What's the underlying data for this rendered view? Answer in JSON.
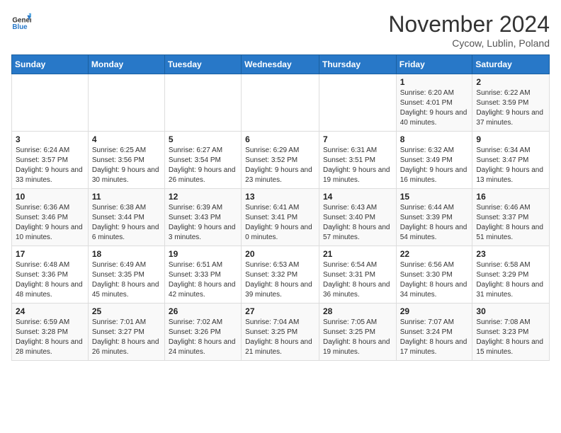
{
  "header": {
    "logo_general": "General",
    "logo_blue": "Blue",
    "month_year": "November 2024",
    "location": "Cycow, Lublin, Poland"
  },
  "weekdays": [
    "Sunday",
    "Monday",
    "Tuesday",
    "Wednesday",
    "Thursday",
    "Friday",
    "Saturday"
  ],
  "weeks": [
    [
      {
        "day": "",
        "info": ""
      },
      {
        "day": "",
        "info": ""
      },
      {
        "day": "",
        "info": ""
      },
      {
        "day": "",
        "info": ""
      },
      {
        "day": "",
        "info": ""
      },
      {
        "day": "1",
        "info": "Sunrise: 6:20 AM\nSunset: 4:01 PM\nDaylight: 9 hours and 40 minutes."
      },
      {
        "day": "2",
        "info": "Sunrise: 6:22 AM\nSunset: 3:59 PM\nDaylight: 9 hours and 37 minutes."
      }
    ],
    [
      {
        "day": "3",
        "info": "Sunrise: 6:24 AM\nSunset: 3:57 PM\nDaylight: 9 hours and 33 minutes."
      },
      {
        "day": "4",
        "info": "Sunrise: 6:25 AM\nSunset: 3:56 PM\nDaylight: 9 hours and 30 minutes."
      },
      {
        "day": "5",
        "info": "Sunrise: 6:27 AM\nSunset: 3:54 PM\nDaylight: 9 hours and 26 minutes."
      },
      {
        "day": "6",
        "info": "Sunrise: 6:29 AM\nSunset: 3:52 PM\nDaylight: 9 hours and 23 minutes."
      },
      {
        "day": "7",
        "info": "Sunrise: 6:31 AM\nSunset: 3:51 PM\nDaylight: 9 hours and 19 minutes."
      },
      {
        "day": "8",
        "info": "Sunrise: 6:32 AM\nSunset: 3:49 PM\nDaylight: 9 hours and 16 minutes."
      },
      {
        "day": "9",
        "info": "Sunrise: 6:34 AM\nSunset: 3:47 PM\nDaylight: 9 hours and 13 minutes."
      }
    ],
    [
      {
        "day": "10",
        "info": "Sunrise: 6:36 AM\nSunset: 3:46 PM\nDaylight: 9 hours and 10 minutes."
      },
      {
        "day": "11",
        "info": "Sunrise: 6:38 AM\nSunset: 3:44 PM\nDaylight: 9 hours and 6 minutes."
      },
      {
        "day": "12",
        "info": "Sunrise: 6:39 AM\nSunset: 3:43 PM\nDaylight: 9 hours and 3 minutes."
      },
      {
        "day": "13",
        "info": "Sunrise: 6:41 AM\nSunset: 3:41 PM\nDaylight: 9 hours and 0 minutes."
      },
      {
        "day": "14",
        "info": "Sunrise: 6:43 AM\nSunset: 3:40 PM\nDaylight: 8 hours and 57 minutes."
      },
      {
        "day": "15",
        "info": "Sunrise: 6:44 AM\nSunset: 3:39 PM\nDaylight: 8 hours and 54 minutes."
      },
      {
        "day": "16",
        "info": "Sunrise: 6:46 AM\nSunset: 3:37 PM\nDaylight: 8 hours and 51 minutes."
      }
    ],
    [
      {
        "day": "17",
        "info": "Sunrise: 6:48 AM\nSunset: 3:36 PM\nDaylight: 8 hours and 48 minutes."
      },
      {
        "day": "18",
        "info": "Sunrise: 6:49 AM\nSunset: 3:35 PM\nDaylight: 8 hours and 45 minutes."
      },
      {
        "day": "19",
        "info": "Sunrise: 6:51 AM\nSunset: 3:33 PM\nDaylight: 8 hours and 42 minutes."
      },
      {
        "day": "20",
        "info": "Sunrise: 6:53 AM\nSunset: 3:32 PM\nDaylight: 8 hours and 39 minutes."
      },
      {
        "day": "21",
        "info": "Sunrise: 6:54 AM\nSunset: 3:31 PM\nDaylight: 8 hours and 36 minutes."
      },
      {
        "day": "22",
        "info": "Sunrise: 6:56 AM\nSunset: 3:30 PM\nDaylight: 8 hours and 34 minutes."
      },
      {
        "day": "23",
        "info": "Sunrise: 6:58 AM\nSunset: 3:29 PM\nDaylight: 8 hours and 31 minutes."
      }
    ],
    [
      {
        "day": "24",
        "info": "Sunrise: 6:59 AM\nSunset: 3:28 PM\nDaylight: 8 hours and 28 minutes."
      },
      {
        "day": "25",
        "info": "Sunrise: 7:01 AM\nSunset: 3:27 PM\nDaylight: 8 hours and 26 minutes."
      },
      {
        "day": "26",
        "info": "Sunrise: 7:02 AM\nSunset: 3:26 PM\nDaylight: 8 hours and 24 minutes."
      },
      {
        "day": "27",
        "info": "Sunrise: 7:04 AM\nSunset: 3:25 PM\nDaylight: 8 hours and 21 minutes."
      },
      {
        "day": "28",
        "info": "Sunrise: 7:05 AM\nSunset: 3:25 PM\nDaylight: 8 hours and 19 minutes."
      },
      {
        "day": "29",
        "info": "Sunrise: 7:07 AM\nSunset: 3:24 PM\nDaylight: 8 hours and 17 minutes."
      },
      {
        "day": "30",
        "info": "Sunrise: 7:08 AM\nSunset: 3:23 PM\nDaylight: 8 hours and 15 minutes."
      }
    ]
  ]
}
